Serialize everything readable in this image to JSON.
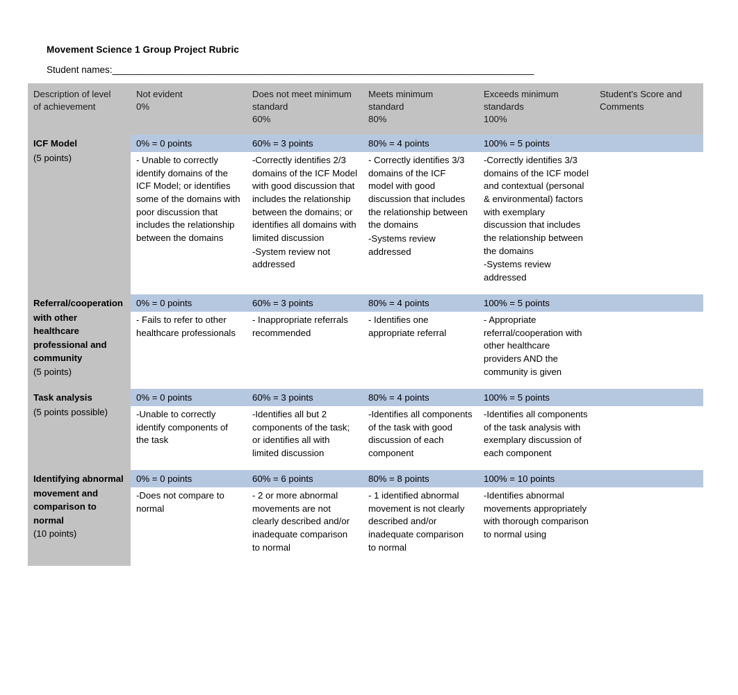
{
  "document": {
    "title": "Movement Science 1 Group Project Rubric",
    "student_names_label": "Student names:",
    "student_names_rule": "___________________________________________________________________________________"
  },
  "table": {
    "headers": [
      {
        "lines": [
          "Description of level",
          "of achievement"
        ]
      },
      {
        "lines": [
          "Not evident",
          "0%"
        ]
      },
      {
        "lines": [
          "Does not meet minimum",
          "standard",
          "60%"
        ]
      },
      {
        "lines": [
          "Meets minimum",
          "standard",
          "80%"
        ]
      },
      {
        "lines": [
          "Exceeds minimum",
          "standards",
          "100%"
        ]
      },
      {
        "lines": [
          "Student's Score and",
          "Comments"
        ]
      }
    ],
    "rows": [
      {
        "criterion": {
          "name_lines": [
            "ICF Model"
          ],
          "points": "(5 points)"
        },
        "scales": [
          "0% = 0 points",
          "60% = 3 points",
          "80% = 4 points",
          "100% = 5 points"
        ],
        "cells": [
          [
            "- Unable to correctly identify domains of the ICF Model; or identifies some of the domains with poor discussion that includes the relationship between the domains"
          ],
          [
            "-Correctly identifies 2/3 domains of the ICF Model with good discussion that includes the relationship between the domains; or identifies all domains with limited discussion",
            "-System review not addressed"
          ],
          [
            "- Correctly identifies 3/3 domains of the ICF model with good discussion that includes the relationship between the domains",
            "-Systems review addressed"
          ],
          [
            "-Correctly identifies 3/3 domains of the ICF model and contextual (personal & environmental) factors with exemplary discussion that includes the relationship between the domains",
            "-Systems review addressed"
          ]
        ],
        "score": ""
      },
      {
        "criterion": {
          "name_lines": [
            "Referral/cooperation",
            "with other",
            "healthcare",
            "professional and",
            "community"
          ],
          "points": "(5 points)"
        },
        "scales": [
          "0% = 0 points",
          "60% = 3 points",
          "80% = 4 points",
          "100% = 5 points"
        ],
        "cells": [
          [
            "- Fails to refer to other healthcare professionals"
          ],
          [
            "- Inappropriate referrals recommended"
          ],
          [
            "-  Identifies one appropriate referral"
          ],
          [
            "- Appropriate referral/cooperation with other healthcare providers AND the community is given"
          ]
        ],
        "score": ""
      },
      {
        "criterion": {
          "name_lines": [
            "Task analysis"
          ],
          "points": "(5 points possible)"
        },
        "scales": [
          "0% = 0 points",
          "60% = 3 points",
          "80% = 4 points",
          "100% = 5 points"
        ],
        "cells": [
          [
            "-Unable to correctly identify components of the task"
          ],
          [
            "-Identifies all but 2 components of the task; or identifies all with limited discussion"
          ],
          [
            "-Identifies all components of the task with good discussion of each component"
          ],
          [
            "-Identifies all components of the task analysis with exemplary discussion of each component"
          ]
        ],
        "score": ""
      },
      {
        "criterion": {
          "name_lines": [
            "Identifying abnormal",
            "movement and",
            "comparison to",
            "normal"
          ],
          "points": "(10 points)"
        },
        "scales": [
          "0% = 0 points",
          "60% = 6 points",
          "80% = 8 points",
          "100% = 10 points"
        ],
        "cells": [
          [
            "-Does not compare to normal"
          ],
          [
            "- 2 or more abnormal movements are not clearly described and/or inadequate comparison to normal"
          ],
          [
            "- 1 identified abnormal movement is not clearly described and/or inadequate comparison to normal"
          ],
          [
            "-Identifies abnormal movements appropriately with thorough comparison to normal using"
          ]
        ],
        "score": ""
      }
    ]
  },
  "colors": {
    "header_gray": "#c2c2c2",
    "scale_blue": "#b6c7e0",
    "page_background": "#ffffff",
    "text": "#000000"
  }
}
